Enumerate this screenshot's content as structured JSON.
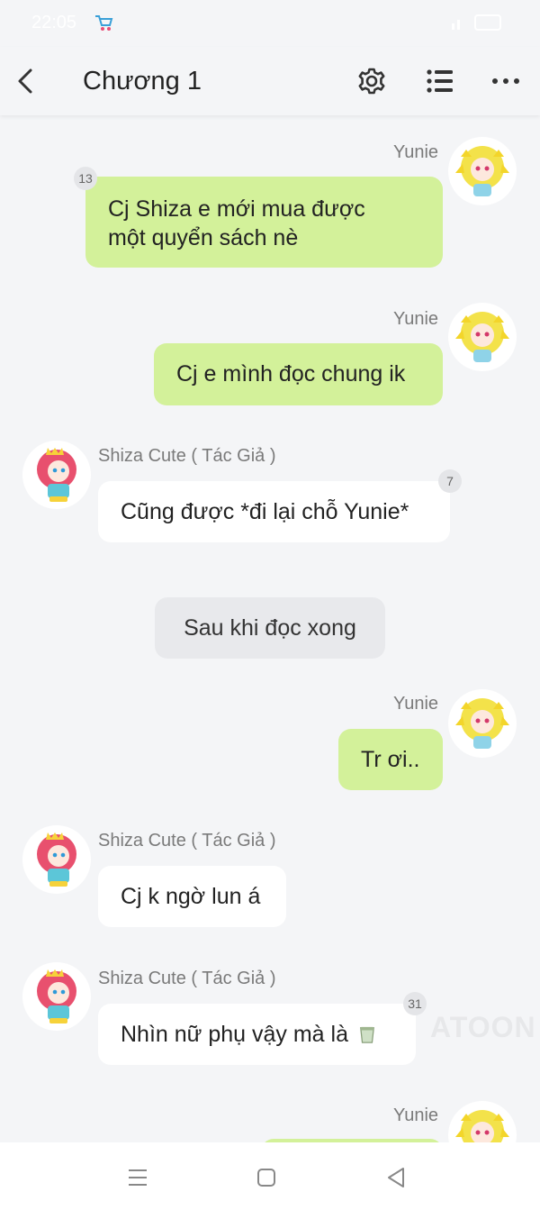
{
  "status_bar": {
    "time": "22:05"
  },
  "app_bar": {
    "title": "Chương 1"
  },
  "messages": [
    {
      "sender": "Yunie",
      "text_lines": [
        "Cj Shiza e mới mua được",
        "một quyển sách nè"
      ],
      "badge": "13",
      "side": "right"
    },
    {
      "sender": "Yunie",
      "text": "Cj e mình đọc chung ik",
      "side": "right"
    },
    {
      "sender": "Shiza Cute ( Tác Giả )",
      "text": "Cũng được *đi lại chỗ Yunie*",
      "badge": "7",
      "side": "left"
    },
    {
      "narration": "Sau khi đọc xong"
    },
    {
      "sender": "Yunie",
      "text": "Tr ơi..",
      "side": "right"
    },
    {
      "sender": "Shiza Cute ( Tác Giả )",
      "text": "Cj k ngờ lun á",
      "side": "left"
    },
    {
      "sender": "Shiza Cute ( Tác Giả )",
      "text": "Nhìn nữ phụ vậy mà là",
      "emoji": "cup-icon",
      "badge": "31",
      "side": "left"
    },
    {
      "sender": "Yunie",
      "side": "right",
      "partial": true
    }
  ],
  "watermark": "ATOON",
  "colors": {
    "background": "#f4f5f7",
    "right_bubble": "#d3f19a",
    "left_bubble": "#ffffff",
    "narration_bubble": "#e8e9ec"
  }
}
